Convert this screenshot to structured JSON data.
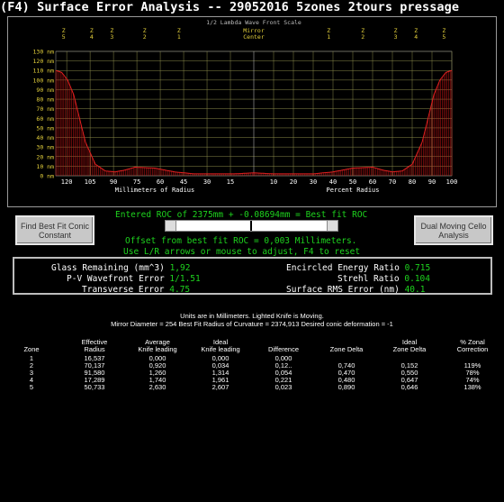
{
  "window": {
    "title": "(F4) Surface Error Analysis -- 29052016  5zones 2tours pressage"
  },
  "chart_data": {
    "type": "area",
    "title": "1/2 Lambda Wave Front Scale",
    "xlabel_left": "Millimeters of Radius",
    "xlabel_right": "Percent Radius",
    "ylabel": "",
    "ylim": [
      0,
      130
    ],
    "yticks": [
      "130 nm",
      "120 nm",
      "110 nm",
      "100 nm",
      "90 nm",
      "80 nm",
      "70 nm",
      "60 nm",
      "50 nm",
      "40 nm",
      "30 nm",
      "20 nm",
      "10 nm",
      "0 nm"
    ],
    "x_left_ticks": [
      "120",
      "105",
      "90",
      "75",
      "60",
      "45",
      "30",
      "15"
    ],
    "x_right_ticks": [
      "10",
      "20",
      "30",
      "40",
      "50",
      "60",
      "70",
      "80",
      "90",
      "100"
    ],
    "center_label": [
      "Mirror",
      "Center"
    ],
    "zone_markers": [
      {
        "label": [
          "Z",
          "5"
        ],
        "side": "left"
      },
      {
        "label": [
          "Z",
          "4"
        ],
        "side": "left"
      },
      {
        "label": [
          "Z",
          "3"
        ],
        "side": "left"
      },
      {
        "label": [
          "Z",
          "2"
        ],
        "side": "left"
      },
      {
        "label": [
          "Z",
          "1"
        ],
        "side": "left"
      },
      {
        "label": [
          "Z",
          "1"
        ],
        "side": "right"
      },
      {
        "label": [
          "Z",
          "2"
        ],
        "side": "right"
      },
      {
        "label": [
          "Z",
          "3"
        ],
        "side": "right"
      },
      {
        "label": [
          "Z",
          "4"
        ],
        "side": "right"
      },
      {
        "label": [
          "Z",
          "5"
        ],
        "side": "right"
      }
    ],
    "profile": {
      "x_percent_radius": [
        0,
        10,
        20,
        30,
        40,
        50,
        60,
        65,
        70,
        75,
        80,
        85,
        88,
        91,
        94,
        97,
        100
      ],
      "error_nm": [
        3,
        2,
        2,
        2,
        4,
        8,
        9,
        6,
        4,
        5,
        12,
        35,
        60,
        85,
        100,
        108,
        110
      ]
    },
    "grid": true
  },
  "buttons": {
    "find_best": "Find Best Fit Conic Constant",
    "dual_moving": "Dual Moving Cello Analysis"
  },
  "controls": {
    "roc_line": "Entered ROC of 2375mm + -0.08694mm = Best fit ROC",
    "offset_line": "Offset from best fit ROC = 0,003 Millimeters.",
    "hint_line": "Use L/R arrows or mouse to adjust, F4 to reset"
  },
  "stats": {
    "glass_remaining_label": "Glass Remaining (mm^3)",
    "glass_remaining_value": "1,92",
    "pv_label": "P-V Wavefront Error",
    "pv_value": "1/1.51",
    "transverse_label": "Transverse Error",
    "transverse_value": "4.75",
    "encircled_label": "Encircled Energy Ratio",
    "encircled_value": "0.715",
    "strehl_label": "Strehl Ratio",
    "strehl_value": "0.104",
    "rms_label": "Surface RMS Error (nm)",
    "rms_value": "40.1"
  },
  "table": {
    "line1": "Units are in Millimeters. Lighted Knife is Moving.",
    "line2": "Mirror Diameter = 254     Best Fit Radius of Curvature = 2374,913     Desired conic deformation = -1",
    "headers": [
      [
        "",
        "Zone"
      ],
      [
        "Effective",
        "Radius"
      ],
      [
        "Average",
        "Knife leading"
      ],
      [
        "Ideal",
        "Knife leading"
      ],
      [
        "",
        "Difference"
      ],
      [
        "",
        "Zone Delta"
      ],
      [
        "Ideal",
        "Zone Delta"
      ],
      [
        "% Zonal",
        "Correction"
      ]
    ],
    "rows": [
      [
        "1",
        "16,537",
        "0,000",
        "0,000",
        "0,000",
        "",
        "",
        ""
      ],
      [
        "2",
        "70,137",
        "0,920",
        "0,034",
        "0,12..",
        "0,740",
        "0,152",
        "119%"
      ],
      [
        "3",
        "91,580",
        "1,260",
        "1,314",
        "0,054",
        "0,470",
        "0,550",
        "78%"
      ],
      [
        "4",
        "17,289",
        "1,740",
        "1,961",
        "0,221",
        "0,480",
        "0,647",
        "74%"
      ],
      [
        "5",
        "50,733",
        "2,630",
        "2,607",
        "0,023",
        "0,890",
        "0,646",
        "138%"
      ]
    ]
  },
  "colors": {
    "background": "#000000",
    "accent_green": "#1ed31e",
    "curve": "#c81414",
    "grid": "#8a8a4a",
    "axis_text": "#e6d23c"
  }
}
